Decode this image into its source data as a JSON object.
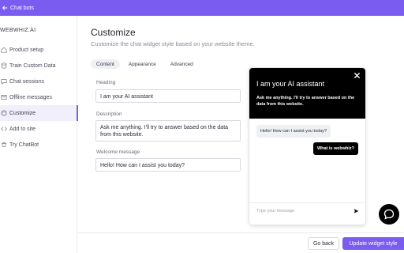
{
  "topbar": {
    "back_label": "Chat bots",
    "back_icon": "arrow-left-icon"
  },
  "sidebar": {
    "brand": "WEBWHIZ.AI",
    "items": [
      {
        "label": "Product setup",
        "icon": "home-icon",
        "active": false
      },
      {
        "label": "Train Custom Data",
        "icon": "database-icon",
        "active": false
      },
      {
        "label": "Chat sessions",
        "icon": "chat-icon",
        "active": false
      },
      {
        "label": "Offline messages",
        "icon": "mail-icon",
        "active": false
      },
      {
        "label": "Customize",
        "icon": "palette-icon",
        "active": true
      },
      {
        "label": "Add to site",
        "icon": "code-icon",
        "active": false
      },
      {
        "label": "Try ChatBot",
        "icon": "bot-icon",
        "active": false
      }
    ]
  },
  "main": {
    "title": "Customize",
    "subtitle": "Customize the chat widget style based on your website theme.",
    "tabs": [
      {
        "label": "Content",
        "active": true
      },
      {
        "label": "Appearance",
        "active": false
      },
      {
        "label": "Advanced",
        "active": false
      }
    ],
    "form": {
      "heading_label": "Heading",
      "heading_value": "I am your AI assistant",
      "description_label": "Description",
      "description_value": "Ask me anything. I'll try to answer based on the data from this website.",
      "welcome_label": "Welcome message",
      "welcome_value": "Hello! How can I assist you today?"
    }
  },
  "preview": {
    "heading": "I am your AI assistant",
    "description": "Ask me anything. I'll try to answer based on the data from this website.",
    "bot_message": "Hello! How can I assist you today?",
    "user_message": "What is webwhiz?",
    "input_placeholder": "Type your message",
    "close_icon": "close-icon",
    "send_icon": "send-icon"
  },
  "launcher": {
    "icon": "chat-bubble-icon"
  },
  "footer": {
    "back_label": "Go back",
    "update_label": "Update widget style"
  },
  "colors": {
    "accent": "#7b5cf0",
    "widget_header": "#000000",
    "active_nav_bg": "#f1effb"
  }
}
